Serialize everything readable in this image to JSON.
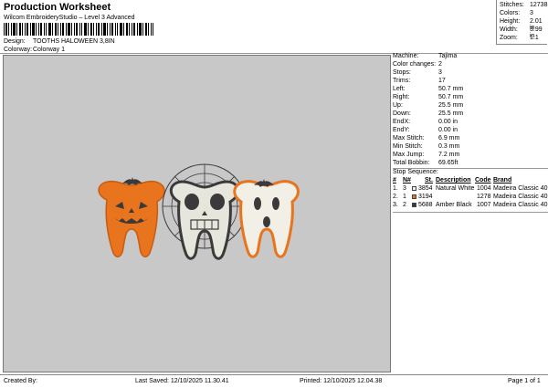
{
  "header": {
    "title": "Production Worksheet",
    "subtitle": "Wilcom EmbroideryStudio – Level 3 Advanced",
    "design_label": "Design:",
    "design_value": "TOOTHS HALOWEEN 3,8IN",
    "colorway_label": "Colorway:",
    "colorway_value": "Colorway 1"
  },
  "stats": [
    {
      "label": "Stitches:",
      "value": "12738"
    },
    {
      "label": "Colors:",
      "value": "3"
    },
    {
      "label": "Height:",
      "value": "2.01 in"
    },
    {
      "label": "Width:",
      "value": "3.99 in"
    },
    {
      "label": "Zoom:",
      "value": "1:1"
    }
  ],
  "machine_info": [
    {
      "label": "Machine:",
      "value": "Tajima"
    },
    {
      "label": "Color changes:",
      "value": "2"
    },
    {
      "label": "Stops:",
      "value": "3"
    },
    {
      "label": "Trims:",
      "value": "17"
    },
    {
      "label": "Left:",
      "value": "50.7 mm"
    },
    {
      "label": "Right:",
      "value": "50.7 mm"
    },
    {
      "label": "Up:",
      "value": "25.5 mm"
    },
    {
      "label": "Down:",
      "value": "25.5 mm"
    },
    {
      "label": "EndX:",
      "value": "0.00 in"
    },
    {
      "label": "EndY:",
      "value": "0.00 in"
    },
    {
      "label": "Max Stitch:",
      "value": "6.9 mm"
    },
    {
      "label": "Min Stitch:",
      "value": "0.3 mm"
    },
    {
      "label": "Max Jump:",
      "value": "7.2 mm"
    },
    {
      "label": "Total Bobbin:",
      "value": "69.65ft"
    }
  ],
  "stop_sequence": {
    "title": "Stop Sequence:",
    "columns": [
      "#",
      "N#",
      "St.",
      "Description",
      "Code",
      "Brand"
    ],
    "rows": [
      {
        "num": "1.",
        "n": "3",
        "color": "#f2f0e6",
        "st": "3854",
        "description": "Natural White",
        "code": "1004",
        "brand": "Madeira Classic 40"
      },
      {
        "num": "2.",
        "n": "1",
        "color": "#e8741e",
        "st": "3194",
        "description": "",
        "code": "1278",
        "brand": "Madeira Classic 40"
      },
      {
        "num": "3.",
        "n": "2",
        "color": "#3a3a3a",
        "st": "5688",
        "description": "Amber Black",
        "code": "1007",
        "brand": "Madeira Classic 40"
      }
    ]
  },
  "footer": {
    "created_by": "Created By:",
    "last_saved": "Last Saved: 12/10/2025 11.30.41",
    "printed": "Printed: 12/10/2025 12.04.38",
    "page": "Page 1 of 1"
  }
}
